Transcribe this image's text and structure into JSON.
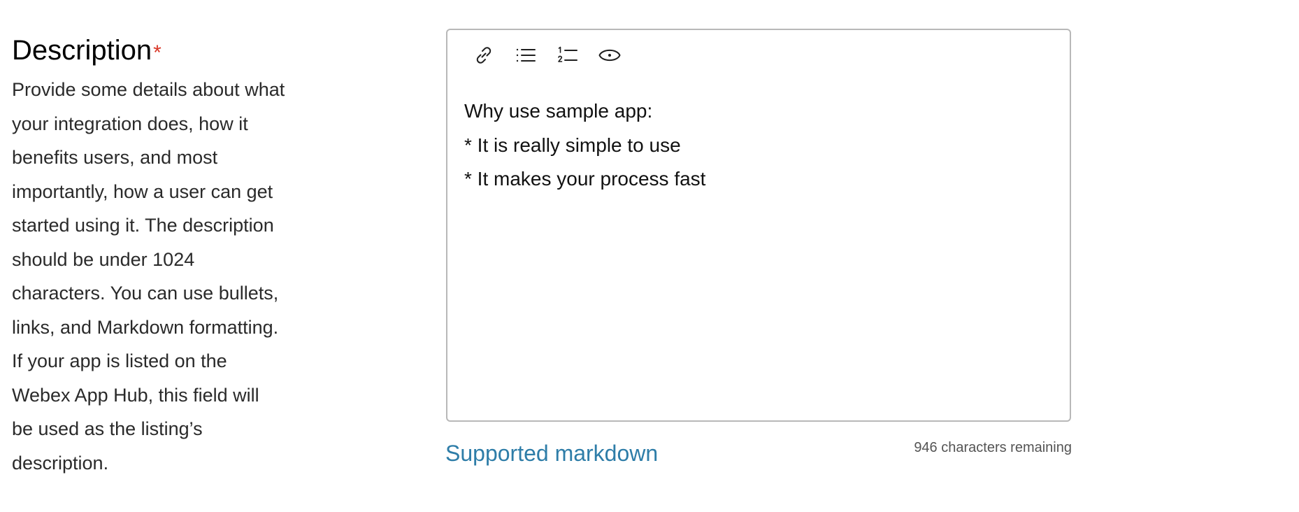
{
  "field": {
    "title": "Description",
    "required_mark": "*",
    "help_text": "Provide some details about what\nyour integration does, how it\nbenefits users, and most\nimportantly, how a user can get\nstarted using it. The description\nshould be under 1024\ncharacters. You can use bullets,\nlinks, and Markdown formatting.\nIf your app is listed on the\nWebex App Hub, this field will\nbe used as the listing’s\ndescription."
  },
  "toolbar": {
    "tools": [
      {
        "icon": "link-icon",
        "action": "insert link"
      },
      {
        "icon": "bulleted-list-icon",
        "action": "bulleted list"
      },
      {
        "icon": "numbered-list-icon",
        "action": "numbered list"
      },
      {
        "icon": "eye-icon",
        "action": "preview"
      }
    ]
  },
  "editor": {
    "lines": [
      "Why use sample app:",
      "* It is really simple to use",
      "* It makes your process fast"
    ]
  },
  "footer": {
    "markdown_link": "Supported markdown",
    "char_remaining": "946 characters remaining"
  },
  "colors": {
    "required": "#d93829",
    "link": "#2e7da8",
    "border": "#b8b8b8"
  }
}
